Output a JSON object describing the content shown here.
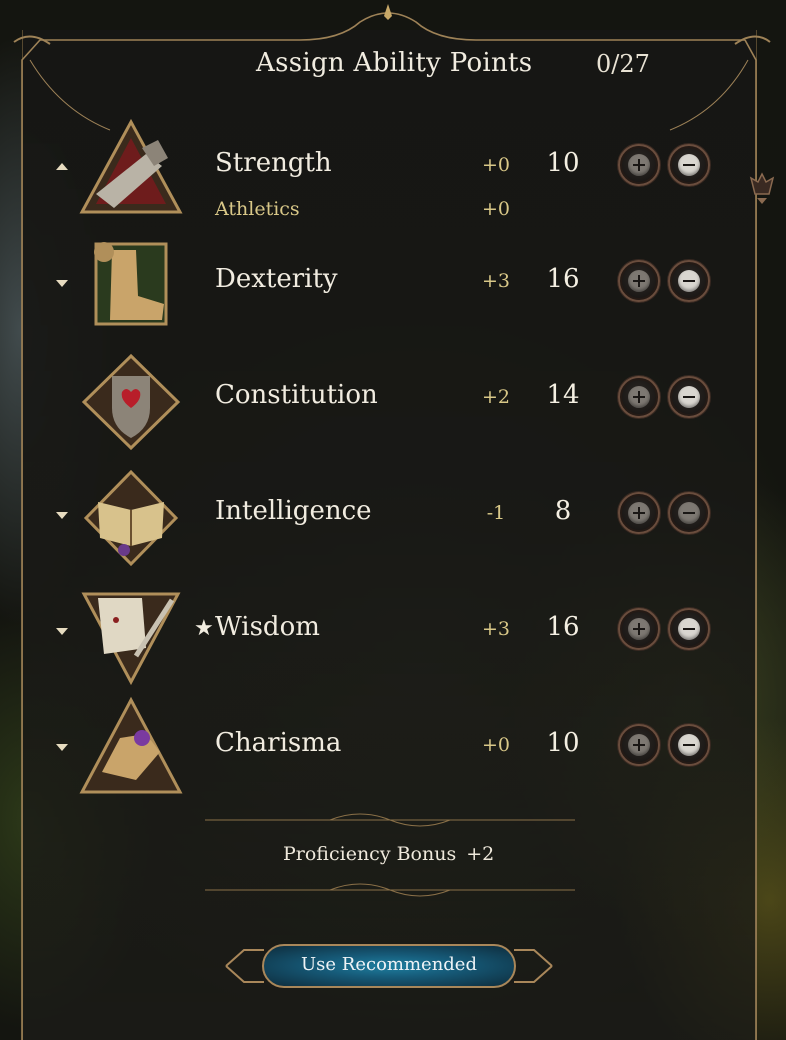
{
  "header": {
    "title": "Assign Ability Points",
    "points": "0/27"
  },
  "abilities": [
    {
      "name": "Strength",
      "modifier": "+0",
      "score": "10",
      "caret": "up",
      "icon": "strength-gauntlet-icon",
      "starred": false
    },
    {
      "name": "Dexterity",
      "modifier": "+3",
      "score": "16",
      "caret": "down",
      "icon": "dexterity-boot-icon",
      "starred": false
    },
    {
      "name": "Constitution",
      "modifier": "+2",
      "score": "14",
      "caret": "none",
      "icon": "constitution-heart-shield-icon",
      "starred": false
    },
    {
      "name": "Intelligence",
      "modifier": "-1",
      "score": "8",
      "caret": "down",
      "icon": "intelligence-book-icon",
      "starred": false
    },
    {
      "name": "Wisdom",
      "modifier": "+3",
      "score": "16",
      "caret": "down",
      "icon": "wisdom-scroll-quill-icon",
      "starred": true,
      "star": "★"
    },
    {
      "name": "Charisma",
      "modifier": "+0",
      "score": "10",
      "caret": "down",
      "icon": "charisma-hand-icon",
      "starred": false
    }
  ],
  "skill": {
    "name": "Athletics",
    "modifier": "+0"
  },
  "proficiency": {
    "label": "Proficiency Bonus",
    "value": "+2"
  },
  "recommended_button": {
    "label": "Use Recommended"
  },
  "colors": {
    "gold": "#d9c888",
    "text": "#f1ece0",
    "button_teal": "#1f7fa0",
    "frame_bronze": "#a9875a"
  }
}
